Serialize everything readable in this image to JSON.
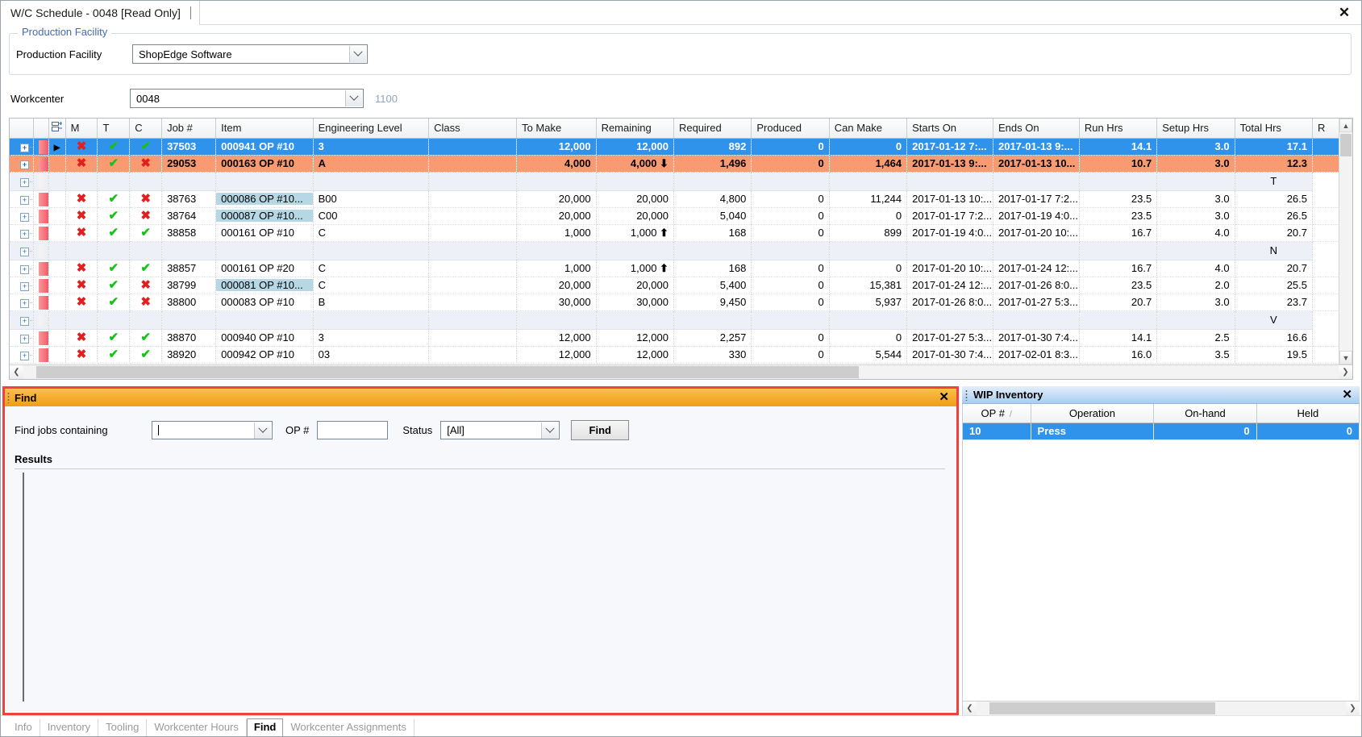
{
  "window": {
    "tab_title": "W/C Schedule - 0048 [Read Only]",
    "close_icon": "✕"
  },
  "production_facility": {
    "legend": "Production Facility",
    "label": "Production Facility",
    "value": "ShopEdge Software"
  },
  "workcenter": {
    "label": "Workcenter",
    "value": "0048",
    "code": "1100"
  },
  "grid": {
    "columns": [
      "M",
      "T",
      "C",
      "Job #",
      "Item",
      "Engineering Level",
      "Class",
      "To Make",
      "Remaining",
      "Required",
      "Produced",
      "Can Make",
      "Starts On",
      "Ends On",
      "Run Hrs",
      "Setup Hrs",
      "Total Hrs",
      "R"
    ],
    "rows": [
      {
        "type": "selected",
        "indicator": "red",
        "selector": "▶",
        "m": "✖",
        "m_state": "no",
        "t": "✔",
        "t_state": "yes",
        "c": "✔",
        "c_state": "yes",
        "job": "37503",
        "item": "000941 OP #10",
        "item_hl": false,
        "eng": "3",
        "class": "",
        "to_make": "12,000",
        "remaining": "12,000",
        "rem_arrow": "",
        "required": "892",
        "produced": "0",
        "can_make": "0",
        "starts_on": "2017-01-12 7:...",
        "ends_on": "2017-01-13 9:...",
        "run_hrs": "14.1",
        "setup_hrs": "3.0",
        "total_hrs": "17.1",
        "r": ""
      },
      {
        "type": "orange",
        "indicator": "red",
        "selector": "",
        "m": "✖",
        "m_state": "no",
        "t": "✔",
        "t_state": "yes",
        "c": "✖",
        "c_state": "no",
        "job": "29053",
        "item": "000163 OP #10",
        "item_hl": false,
        "eng": "A",
        "class": "",
        "to_make": "4,000",
        "remaining": "4,000",
        "rem_arrow": "⬇",
        "required": "1,496",
        "produced": "0",
        "can_make": "1,464",
        "starts_on": "2017-01-13 9:...",
        "ends_on": "2017-01-13 10...",
        "run_hrs": "10.7",
        "setup_hrs": "3.0",
        "total_hrs": "12.3",
        "r": ""
      },
      {
        "type": "group",
        "r": "T"
      },
      {
        "type": "normal",
        "indicator": "red",
        "selector": "",
        "m": "✖",
        "m_state": "no",
        "t": "✔",
        "t_state": "yes",
        "c": "✖",
        "c_state": "no",
        "job": "38763",
        "item": "000086 OP #10...",
        "item_hl": true,
        "eng": "B00",
        "class": "",
        "to_make": "20,000",
        "remaining": "20,000",
        "rem_arrow": "",
        "required": "4,800",
        "produced": "0",
        "can_make": "11,244",
        "starts_on": "2017-01-13  10:...",
        "ends_on": "2017-01-17  7:2...",
        "run_hrs": "23.5",
        "setup_hrs": "3.0",
        "total_hrs": "26.5",
        "r": ""
      },
      {
        "type": "normal",
        "indicator": "red",
        "selector": "",
        "m": "✖",
        "m_state": "no",
        "t": "✔",
        "t_state": "yes",
        "c": "✖",
        "c_state": "no",
        "job": "38764",
        "item": "000087 OP #10...",
        "item_hl": true,
        "eng": "C00",
        "class": "",
        "to_make": "20,000",
        "remaining": "20,000",
        "rem_arrow": "",
        "required": "5,040",
        "produced": "0",
        "can_make": "0",
        "starts_on": "2017-01-17  7:2...",
        "ends_on": "2017-01-19  4:0...",
        "run_hrs": "23.5",
        "setup_hrs": "3.0",
        "total_hrs": "26.5",
        "r": ""
      },
      {
        "type": "normal",
        "indicator": "red",
        "selector": "",
        "m": "✖",
        "m_state": "no",
        "t": "✔",
        "t_state": "yes",
        "c": "✔",
        "c_state": "yes",
        "job": "38858",
        "item": "000161 OP #10",
        "item_hl": false,
        "eng": "C",
        "class": "",
        "to_make": "1,000",
        "remaining": "1,000",
        "rem_arrow": "⬆",
        "required": "168",
        "produced": "0",
        "can_make": "899",
        "starts_on": "2017-01-19  4:0...",
        "ends_on": "2017-01-20  10:...",
        "run_hrs": "16.7",
        "setup_hrs": "4.0",
        "total_hrs": "20.7",
        "r": ""
      },
      {
        "type": "group",
        "r": "N"
      },
      {
        "type": "normal",
        "indicator": "red",
        "selector": "",
        "m": "✖",
        "m_state": "no",
        "t": "✔",
        "t_state": "yes",
        "c": "✔",
        "c_state": "yes",
        "job": "38857",
        "item": "000161 OP #20",
        "item_hl": false,
        "eng": "C",
        "class": "",
        "to_make": "1,000",
        "remaining": "1,000",
        "rem_arrow": "⬆",
        "required": "168",
        "produced": "0",
        "can_make": "0",
        "starts_on": "2017-01-20  10:...",
        "ends_on": "2017-01-24  12:...",
        "run_hrs": "16.7",
        "setup_hrs": "4.0",
        "total_hrs": "20.7",
        "r": ""
      },
      {
        "type": "normal",
        "indicator": "red",
        "selector": "",
        "m": "✖",
        "m_state": "no",
        "t": "✔",
        "t_state": "yes",
        "c": "✖",
        "c_state": "no",
        "job": "38799",
        "item": "000081 OP #10...",
        "item_hl": true,
        "eng": "C",
        "class": "",
        "to_make": "20,000",
        "remaining": "20,000",
        "rem_arrow": "",
        "required": "5,400",
        "produced": "0",
        "can_make": "15,381",
        "starts_on": "2017-01-24  12:...",
        "ends_on": "2017-01-26 8:0...",
        "run_hrs": "23.5",
        "setup_hrs": "2.0",
        "total_hrs": "25.5",
        "r": ""
      },
      {
        "type": "normal",
        "indicator": "red",
        "selector": "",
        "m": "✖",
        "m_state": "no",
        "t": "✔",
        "t_state": "yes",
        "c": "✖",
        "c_state": "no",
        "job": "38800",
        "item": "000083 OP #10",
        "item_hl": false,
        "eng": "B",
        "class": "",
        "to_make": "30,000",
        "remaining": "30,000",
        "rem_arrow": "",
        "required": "9,450",
        "produced": "0",
        "can_make": "5,937",
        "starts_on": "2017-01-26 8:0...",
        "ends_on": "2017-01-27  5:3...",
        "run_hrs": "20.7",
        "setup_hrs": "3.0",
        "total_hrs": "23.7",
        "r": ""
      },
      {
        "type": "group",
        "r": "V"
      },
      {
        "type": "normal",
        "indicator": "red",
        "selector": "",
        "m": "✖",
        "m_state": "no",
        "t": "✔",
        "t_state": "yes",
        "c": "✔",
        "c_state": "yes",
        "job": "38870",
        "item": "000940 OP #10",
        "item_hl": false,
        "eng": "3",
        "class": "",
        "to_make": "12,000",
        "remaining": "12,000",
        "rem_arrow": "",
        "required": "2,257",
        "produced": "0",
        "can_make": "0",
        "starts_on": "2017-01-27  5:3...",
        "ends_on": "2017-01-30  7:4...",
        "run_hrs": "14.1",
        "setup_hrs": "2.5",
        "total_hrs": "16.6",
        "r": ""
      },
      {
        "type": "normal",
        "indicator": "red",
        "selector": "",
        "m": "✖",
        "m_state": "no",
        "t": "✔",
        "t_state": "yes",
        "c": "✔",
        "c_state": "yes",
        "job": "38920",
        "item": "000942 OP #10",
        "item_hl": false,
        "eng": "03",
        "class": "",
        "to_make": "12,000",
        "remaining": "12,000",
        "rem_arrow": "",
        "required": "330",
        "produced": "0",
        "can_make": "5,544",
        "starts_on": "2017-01-30  7:4...",
        "ends_on": "2017-02-01  8:3...",
        "run_hrs": "16.0",
        "setup_hrs": "3.5",
        "total_hrs": "19.5",
        "r": ""
      }
    ]
  },
  "find_panel": {
    "caption": "Find",
    "close_icon": "✕",
    "find_jobs_label": "Find jobs containing",
    "find_jobs_value": "",
    "op_label": "OP #",
    "op_value": "",
    "status_label": "Status",
    "status_value": "[All]",
    "find_button": "Find",
    "results_label": "Results"
  },
  "wip_panel": {
    "caption": "WIP Inventory",
    "close_icon": "✕",
    "columns": [
      "OP #",
      "Operation",
      "On-hand",
      "Held"
    ],
    "sort_mark": "/",
    "rows": [
      {
        "op": "10",
        "operation": "Press",
        "on_hand": "0",
        "held": "0"
      }
    ]
  },
  "tabs": [
    {
      "label": "Info",
      "active": false
    },
    {
      "label": "Inventory",
      "active": false
    },
    {
      "label": "Tooling",
      "active": false
    },
    {
      "label": "Workcenter Hours",
      "active": false
    },
    {
      "label": "Find",
      "active": true
    },
    {
      "label": "Workcenter Assignments",
      "active": false
    }
  ],
  "colors": {
    "selection_blue": "#2f93ec",
    "highlight_orange": "#f89b72",
    "find_caption": "#ef9d18",
    "find_border": "#f04040",
    "wip_caption": "#a9cdf0",
    "link_blue": "#4668b5",
    "mark_red": "#e02020",
    "mark_green": "#17c217"
  }
}
